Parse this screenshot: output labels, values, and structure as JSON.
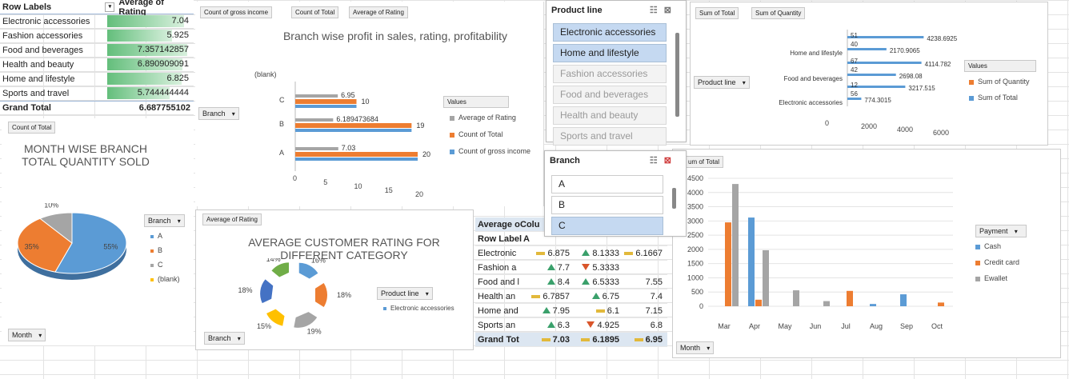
{
  "pivot1": {
    "header_rows": "Row Labels",
    "header_avg": "Average of Rating",
    "rows": [
      {
        "label": "Electronic accessories",
        "value": "7.04",
        "v": 7.04
      },
      {
        "label": "Fashion accessories",
        "value": "5.925",
        "v": 5.925
      },
      {
        "label": "Food and beverages",
        "value": "7.357142857",
        "v": 7.357142857
      },
      {
        "label": "Health and beauty",
        "value": "6.890909091",
        "v": 6.890909091
      },
      {
        "label": "Home and lifestyle",
        "value": "6.825",
        "v": 6.825
      },
      {
        "label": "Sports and travel",
        "value": "5.744444444",
        "v": 5.744444444
      }
    ],
    "total_label": "Grand Total",
    "total_value": "6.687755102"
  },
  "chart1": {
    "buttons": [
      "Count of gross income",
      "Count of Total",
      "Average of Rating"
    ],
    "title": "Branch wise profit in sales, rating, profitability",
    "blank_label": "(blank)",
    "branch_btn": "Branch",
    "legend_title": "Values",
    "colors": {
      "avg": "#a5a5a5",
      "count_total": "#ed7d31",
      "gross": "#5b9bd5"
    }
  },
  "chart_data": [
    {
      "type": "bar",
      "title": "Branch wise profit in sales, rating, profitability",
      "categories": [
        "A",
        "B",
        "C",
        "(blank)"
      ],
      "series": [
        {
          "name": "Average of Rating",
          "values": [
            7.03,
            6.189473684,
            6.95,
            null
          ]
        },
        {
          "name": "Count of Total",
          "values": [
            20,
            19,
            10,
            null
          ]
        },
        {
          "name": "Count of gross income",
          "values": [
            20,
            19,
            10,
            null
          ]
        }
      ],
      "xlim": [
        0,
        20
      ],
      "xticks": [
        "0",
        "5",
        "10",
        "15",
        "20"
      ],
      "data_labels": [
        "7.03",
        "20",
        "6.189473684",
        "19",
        "6.95",
        "10"
      ]
    },
    {
      "type": "pie",
      "title": "MONTH WISE BRANCH TOTAL QUANTITY SOLD",
      "categories": [
        "A",
        "B",
        "C",
        "(blank)"
      ],
      "values": [
        55,
        35,
        10,
        0
      ],
      "labels": [
        "55%",
        "35%",
        "10%"
      ],
      "colors": [
        "#5b9bd5",
        "#ed7d31",
        "#a5a5a5",
        "#ffc000"
      ]
    },
    {
      "type": "pie",
      "title": "AVERAGE CUSTOMER RATING FOR DIFFERENT CATEGORY",
      "labels": [
        "16%",
        "18%",
        "19%",
        "15%",
        "18%",
        "14%"
      ],
      "values": [
        16,
        18,
        19,
        15,
        18,
        14
      ],
      "colors": [
        "#5b9bd5",
        "#ed7d31",
        "#a5a5a5",
        "#ffc000",
        "#4472c4",
        "#70ad47"
      ]
    },
    {
      "type": "bar",
      "title": "",
      "categories": [
        "Home and lifestyle",
        "Food and beverages",
        "Electronic accessories"
      ],
      "series": [
        {
          "name": "Sum of Quantity",
          "values": [
            51,
            42,
            56
          ]
        },
        {
          "name": "Sum of Total",
          "values": [
            4238.6925,
            4114.782,
            3217.515
          ]
        }
      ],
      "extra_labels": [
        "40",
        "2170.9065",
        "67",
        "2698.08",
        "12",
        "774.3015"
      ],
      "xticks": [
        "0",
        "2000",
        "4000",
        "6000"
      ]
    },
    {
      "type": "bar",
      "title": "Sum of Total",
      "categories": [
        "Mar",
        "Apr",
        "May",
        "Jun",
        "Jul",
        "Aug",
        "Sep",
        "Oct"
      ],
      "series": [
        {
          "name": "Cash",
          "values": [
            0,
            3120,
            0,
            0,
            0,
            80,
            420,
            0
          ]
        },
        {
          "name": "Credit card",
          "values": [
            2950,
            230,
            0,
            0,
            540,
            0,
            0,
            130
          ]
        },
        {
          "name": "Ewallet",
          "values": [
            4300,
            1970,
            560,
            180,
            0,
            0,
            0,
            0
          ]
        }
      ],
      "ylim": [
        0,
        4500
      ],
      "yticks": [
        "0",
        "500",
        "1000",
        "1500",
        "2000",
        "2500",
        "3000",
        "3500",
        "4000",
        "4500"
      ]
    }
  ],
  "pie1": {
    "btn": "Count of Total",
    "title1": "MONTH WISE BRANCH",
    "title2": "TOTAL QUANTITY SOLD",
    "legend_btn": "Branch",
    "legend": [
      "A",
      "B",
      "C",
      "(blank)"
    ],
    "month_btn": "Month"
  },
  "pie2": {
    "btn": "Average of Rating",
    "title1": "AVERAGE CUSTOMER RATING FOR",
    "title2": "DIFFERENT CATEGORY",
    "prod_btn": "Product line",
    "legend": "Electronic accessories",
    "branch_btn": "Branch"
  },
  "slicer_product": {
    "title": "Product line",
    "items": [
      "Electronic accessories",
      "Home and lifestyle",
      "Fashion accessories",
      "Food and beverages",
      "Health and beauty",
      "Sports and travel"
    ]
  },
  "slicer_branch": {
    "title": "Branch",
    "items": [
      "A",
      "B",
      "C"
    ]
  },
  "chart4": {
    "buttons": [
      "Sum of Total",
      "Sum of Quantity"
    ],
    "prod_btn": "Product line",
    "legend_title": "Values",
    "legend": [
      "Sum of Quantity",
      "Sum of Total"
    ]
  },
  "chart5": {
    "btn": "um of Total",
    "legend_btn": "Payment",
    "legend": [
      "Cash",
      "Credit card",
      "Ewallet"
    ],
    "month_btn": "Month"
  },
  "pivot2": {
    "header": "Average o",
    "header2": "Colu",
    "row_label": "Row Label",
    "col_a": "A",
    "rows": [
      {
        "l": "Electronic",
        "a": "6.875",
        "ai": "dash",
        "b": "8.1333",
        "bi": "up",
        "c": "6.1667",
        "ci": "dash"
      },
      {
        "l": "Fashion a",
        "a": "7.7",
        "ai": "up",
        "b": "5.3333",
        "bi": "down",
        "c": "",
        "ci": ""
      },
      {
        "l": "Food and l",
        "a": "8.4",
        "ai": "up",
        "b": "6.5333",
        "bi": "up",
        "c": "7.55",
        "ci": ""
      },
      {
        "l": "Health an",
        "a": "6.7857",
        "ai": "dash",
        "b": "6.75",
        "bi": "up",
        "c": "7.4",
        "ci": ""
      },
      {
        "l": "Home and",
        "a": "7.95",
        "ai": "up",
        "b": "6.1",
        "bi": "dash",
        "c": "7.15",
        "ci": ""
      },
      {
        "l": "Sports an",
        "a": "6.3",
        "ai": "up",
        "b": "4.925",
        "bi": "down",
        "c": "6.8",
        "ci": ""
      }
    ],
    "total": {
      "l": "Grand Tot",
      "a": "7.03",
      "b": "6.1895",
      "c": "6.95"
    }
  }
}
